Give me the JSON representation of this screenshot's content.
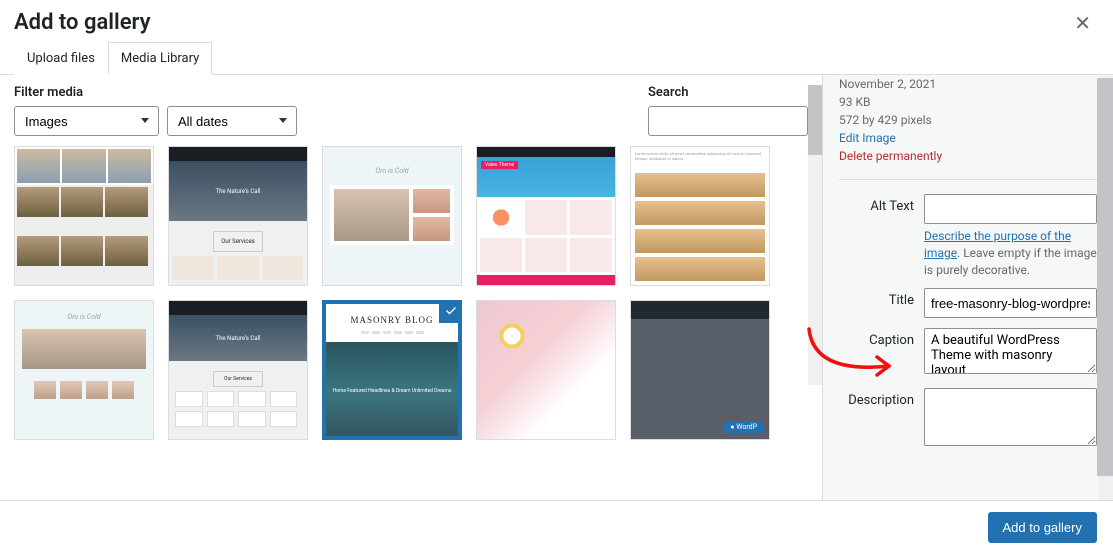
{
  "modal": {
    "title": "Add to gallery"
  },
  "tabs": {
    "upload": "Upload files",
    "library": "Media Library"
  },
  "filter": {
    "label": "Filter media",
    "type_value": "Images",
    "date_value": "All dates"
  },
  "search": {
    "label": "Search",
    "value": ""
  },
  "thumbs": {
    "oro": "Oro is Cold",
    "nature": "The Nature's Call",
    "ourServices": "Our Services",
    "masonry": "MASONRY BLOG",
    "masonrySub": "Home Featured Headlines &\nDream Unlimited Dreams",
    "wordp": "WordP",
    "valeo": "Valeo Theme"
  },
  "details": {
    "date": "November 2, 2021",
    "size": "93 KB",
    "dims": "572 by 429 pixels",
    "editLink": "Edit Image",
    "deleteLink": "Delete permanently",
    "altLabel": "Alt Text",
    "altValue": "",
    "altHelpLink": "Describe the purpose of the image",
    "altHelpRest": ". Leave empty if the image is purely decorative.",
    "titleLabel": "Title",
    "titleValue": "free-masonry-blog-wordpress-theme",
    "captionLabel": "Caption",
    "captionValue": "A beautiful WordPress Theme with masonry layout",
    "descLabel": "Description",
    "descValue": ""
  },
  "footer": {
    "submit": "Add to gallery"
  }
}
